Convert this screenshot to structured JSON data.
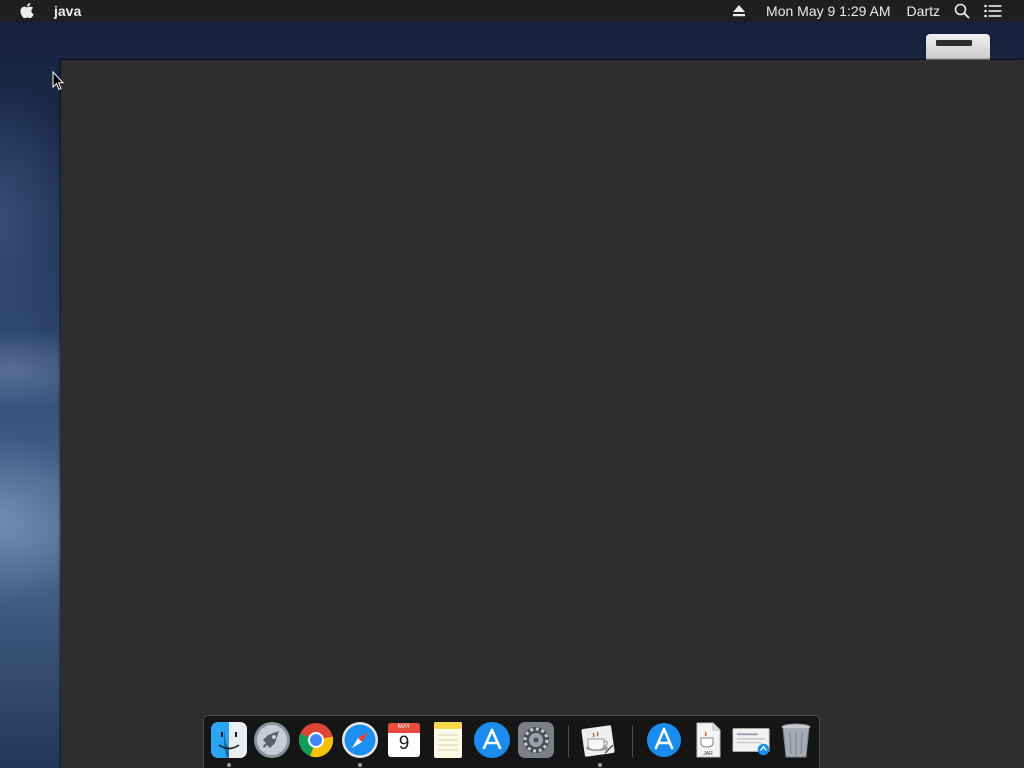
{
  "menubar": {
    "apple_icon": "apple-icon",
    "app_name": "java",
    "clock": "Mon May 9  1:29 AM",
    "username": "Dartz",
    "status_icons": [
      "eject-icon",
      "spotlight-icon",
      "notification-center-icon"
    ]
  },
  "desktop": {
    "icons": [
      "external-drive-icon"
    ]
  },
  "window": {
    "background": "#2e2e2e"
  },
  "dock": {
    "items": [
      {
        "name": "Finder",
        "icon": "finder-icon",
        "running": true
      },
      {
        "name": "Launchpad",
        "icon": "launchpad-icon",
        "running": false
      },
      {
        "name": "Google Chrome",
        "icon": "chrome-icon",
        "running": false
      },
      {
        "name": "Safari",
        "icon": "safari-icon",
        "running": true
      },
      {
        "name": "Calendar",
        "icon": "calendar-icon",
        "running": false,
        "month": "MAY",
        "day": "9"
      },
      {
        "name": "Notes",
        "icon": "notes-icon",
        "running": false
      },
      {
        "name": "App Store",
        "icon": "app-store-icon",
        "running": false
      },
      {
        "name": "System Preferences",
        "icon": "system-preferences-icon",
        "running": false
      },
      {
        "name": "Java",
        "icon": "java-icon",
        "running": true
      },
      {
        "name": "Applications",
        "icon": "applications-folder-icon",
        "running": false
      },
      {
        "name": "JAR file",
        "icon": "jar-file-icon",
        "running": false,
        "label": "JAR"
      },
      {
        "name": "Downloads",
        "icon": "downloads-icon",
        "running": false
      },
      {
        "name": "Trash",
        "icon": "trash-icon",
        "running": false
      }
    ]
  }
}
